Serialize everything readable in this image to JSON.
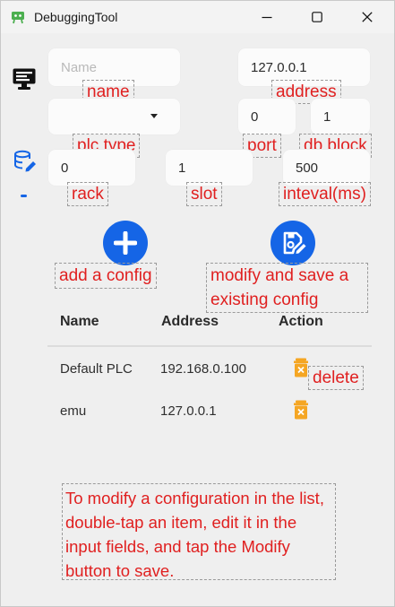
{
  "window": {
    "title": "DebuggingTool",
    "controls": {
      "minimize": "—",
      "maximize": "☐",
      "close": "✕"
    }
  },
  "sidebar": {
    "items": [
      {
        "name": "monitor-icon"
      },
      {
        "name": "database-edit-icon",
        "active": true
      }
    ]
  },
  "form": {
    "name": {
      "value": "",
      "placeholder": "Name"
    },
    "address": {
      "value": "127.0.0.1"
    },
    "plc_type": {
      "value": ""
    },
    "port": {
      "value": "0"
    },
    "db_block": {
      "value": "1"
    },
    "rack": {
      "value": "0"
    },
    "slot": {
      "value": "1"
    },
    "interval": {
      "value": "500"
    }
  },
  "annotations": {
    "name": "name",
    "address": "address",
    "plc_type": "plc type",
    "port": "port",
    "db_block": "db block",
    "rack": "rack",
    "slot": "slot",
    "interval": "inteval(ms)",
    "add": "add a config",
    "modify": "modify and save a existing config",
    "delete": "delete",
    "help": "To modify a configuration in the list, double-tap an item, edit it in the input fields, and tap the Modify button to save."
  },
  "buttons": {
    "add_icon": "plus-icon",
    "modify_icon": "save-edit-icon"
  },
  "table": {
    "headers": [
      "Name",
      "Address",
      "Action"
    ],
    "rows": [
      {
        "name": "Default PLC",
        "address": "192.168.0.100"
      },
      {
        "name": "emu",
        "address": "127.0.0.1"
      }
    ]
  },
  "colors": {
    "accent": "#1565e6",
    "annotation": "#e02020",
    "delete": "#f5a623"
  }
}
